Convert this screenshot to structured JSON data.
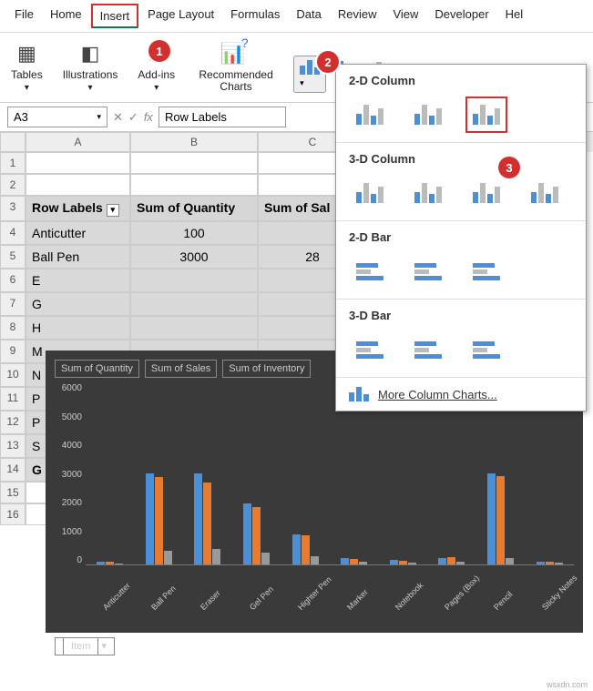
{
  "menubar": {
    "items": [
      "File",
      "Home",
      "Insert",
      "Page Layout",
      "Formulas",
      "Data",
      "Review",
      "View",
      "Developer",
      "Hel"
    ],
    "active_index": 2
  },
  "ribbon": {
    "groups": [
      {
        "label": "Tables",
        "caret": true,
        "icon": "table-icon"
      },
      {
        "label": "Illustrations",
        "caret": true,
        "icon": "shapes-icon"
      },
      {
        "label": "Add-ins",
        "caret": true,
        "icon": "addins-icon"
      },
      {
        "label": "Recommended Charts",
        "caret": false,
        "icon": "recommended-icon"
      }
    ]
  },
  "badge1": "1",
  "badge2": "2",
  "badge3": "3",
  "namebox": "A3",
  "formula": "Row Labels",
  "columns": [
    "A",
    "B",
    "C"
  ],
  "table": {
    "headers": [
      "Row Labels",
      "Sum of Quantity",
      "Sum of Sal"
    ],
    "rows": [
      {
        "label": "Anticutter",
        "qty": "100",
        "sales": ""
      },
      {
        "label": "Ball Pen",
        "qty": "3000",
        "sales": "28"
      },
      {
        "label": "E",
        "qty": "",
        "sales": ""
      },
      {
        "label": "G",
        "qty": "",
        "sales": ""
      },
      {
        "label": "H",
        "qty": "",
        "sales": ""
      },
      {
        "label": "M",
        "qty": "",
        "sales": ""
      },
      {
        "label": "N",
        "qty": "",
        "sales": ""
      },
      {
        "label": "P",
        "qty": "",
        "sales": ""
      },
      {
        "label": "P",
        "qty": "",
        "sales": ""
      },
      {
        "label": "S",
        "qty": "",
        "sales": ""
      },
      {
        "label": "G",
        "qty": "",
        "sales": ""
      }
    ]
  },
  "row_numbers": [
    1,
    2,
    3,
    4,
    5,
    6,
    7,
    8,
    9,
    10,
    11,
    12,
    13,
    14,
    15,
    16
  ],
  "dropdown": {
    "sections": [
      {
        "title": "2-D Column",
        "count": 3,
        "highlight_index": 2
      },
      {
        "title": "3-D Column",
        "count": 4
      },
      {
        "title": "2-D Bar",
        "count": 3
      },
      {
        "title": "3-D Bar",
        "count": 3
      }
    ],
    "more": "More Column Charts..."
  },
  "chart_data": {
    "type": "bar",
    "title": "",
    "legend": [
      "Sum of Quantity",
      "Sum of Sales",
      "Sum of Inventory"
    ],
    "categories": [
      "Anticutter",
      "Ball Pen",
      "Eraser",
      "Gel Pen",
      "Highter Pen",
      "Marker",
      "Notebook",
      "Pages (Box)",
      "Pencil",
      "Sticky Notes"
    ],
    "series": [
      {
        "name": "Sum of Quantity",
        "values": [
          100,
          3000,
          3000,
          2000,
          1000,
          200,
          150,
          200,
          3000,
          100
        ]
      },
      {
        "name": "Sum of Sales",
        "values": [
          80,
          2870,
          2700,
          1900,
          950,
          180,
          120,
          250,
          2900,
          90
        ]
      },
      {
        "name": "Sum of Inventory",
        "values": [
          40,
          450,
          500,
          400,
          280,
          100,
          60,
          80,
          200,
          50
        ]
      }
    ],
    "ylim": [
      0,
      6000
    ],
    "yticks": [
      0,
      1000,
      2000,
      3000,
      4000,
      5000,
      6000
    ],
    "footer_label": "Item"
  },
  "watermark": "wsxdn.com"
}
